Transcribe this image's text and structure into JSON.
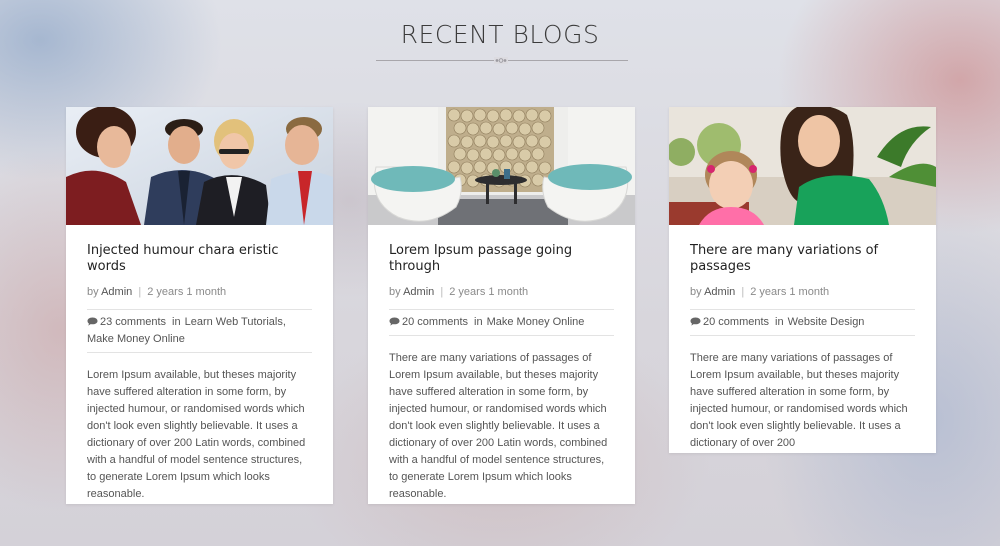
{
  "section": {
    "title": "RECENT BLOGS"
  },
  "cards": [
    {
      "title": "Injected humour chara eristic words",
      "by": "by",
      "author": "Admin",
      "date": "2 years 1 month",
      "comments": "23 comments",
      "in_label": "in",
      "categories": "Learn Web Tutorials, Make Money Online",
      "excerpt": "Lorem Ipsum available, but theses majority have suffered alteration in some form, by injected humour, or randomised words which don't look even slightly believable. It uses a dictionary of over 200 Latin words, combined with a handful of model sentence structures, to generate Lorem Ipsum which looks reasonable.",
      "image": "business-team-photo"
    },
    {
      "title": "Lorem Ipsum passage going through",
      "by": "by",
      "author": "Admin",
      "date": "2 years 1 month",
      "comments": "20 comments",
      "in_label": "in",
      "categories": "Make Money Online",
      "excerpt": "There are many variations of passages of Lorem Ipsum available, but theses majority have suffered alteration in some form, by injected humour, or randomised words which don't look even slightly believable. It uses a dictionary of over 200 Latin words, combined with a handful of model sentence structures, to generate Lorem Ipsum which looks reasonable.",
      "image": "lounge-chairs-photo"
    },
    {
      "title": "There are many variations of passages",
      "by": "by",
      "author": "Admin",
      "date": "2 years 1 month",
      "comments": "20 comments",
      "in_label": "in",
      "categories": "Website Design",
      "excerpt": "There are many variations of passages of Lorem Ipsum available, but theses majority have suffered alteration in some form, by injected humour, or randomised words which don't look even slightly believable. It uses a dictionary of over 200",
      "image": "mother-child-photo"
    }
  ],
  "colors": {
    "title": "#3b3b3b",
    "text": "#555555",
    "meta": "#8a8a8a",
    "divider": "#e3e3e3"
  }
}
